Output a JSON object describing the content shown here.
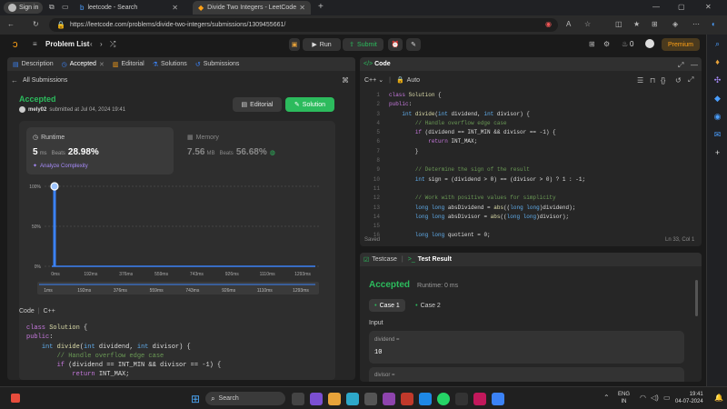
{
  "browser": {
    "signin": "Sign in",
    "tabs": [
      {
        "title": "leetcode - Search"
      },
      {
        "title": "Divide Two Integers - LeetCode"
      }
    ],
    "url": "https://leetcode.com/problems/divide-two-integers/submissions/1309455661/"
  },
  "nav": {
    "problem_list": "Problem List",
    "run": "Run",
    "submit": "Submit",
    "streak": "0",
    "premium": "Premium"
  },
  "left_tabs": [
    "Description",
    "Accepted",
    "Editorial",
    "Solutions",
    "Submissions"
  ],
  "submission": {
    "back": "All Submissions",
    "status": "Accepted",
    "user": "mely02",
    "submitted_text": "submitted at Jul 04, 2024 19:41",
    "editorial_btn": "Editorial",
    "solution_btn": "Solution",
    "runtime_label": "Runtime",
    "runtime_value": "5",
    "runtime_unit": "ms",
    "beats_label": "Beats",
    "runtime_beats": "28.98%",
    "analyze": "Analyze Complexity",
    "memory_label": "Memory",
    "memory_value": "7.56",
    "memory_unit": "MB",
    "memory_beats": "56.68%"
  },
  "chart_data": {
    "type": "bar",
    "ytick_labels": [
      "100%",
      "50%",
      "0%"
    ],
    "x_labels": [
      "0ms",
      "192ms",
      "376ms",
      "559ms",
      "743ms",
      "926ms",
      "1110ms",
      "1293ms"
    ],
    "mini_labels": [
      "1ms",
      "192ms",
      "376ms",
      "559ms",
      "743ms",
      "926ms",
      "1110ms",
      "1293ms"
    ],
    "bars": [
      {
        "x_ms": 5,
        "pct": 100,
        "color": "#3b82f6"
      },
      {
        "x_ms": 0,
        "pct": 0
      }
    ],
    "highlight_ms": 5,
    "ylim": [
      0,
      100
    ]
  },
  "bottom_code": {
    "label": "Code",
    "lang": "C++",
    "lines": [
      "class Solution {",
      "public:",
      "    int divide(int dividend, int divisor) {",
      "        // Handle overflow edge case",
      "        if (dividend == INT_MIN && divisor == -1) {",
      "            return INT_MAX;"
    ]
  },
  "editor": {
    "title": "Code",
    "lang": "C++",
    "mode": "Auto",
    "saved": "Saved",
    "cursor": "Ln 33, Col 1",
    "lines": [
      "class Solution {",
      "public:",
      "    int divide(int dividend, int divisor) {",
      "        // Handle overflow edge case",
      "        if (dividend == INT_MIN && divisor == -1) {",
      "            return INT_MAX;",
      "        }",
      "",
      "        // Determine the sign of the result",
      "        int sign = (dividend > 0) == (divisor > 0) ? 1 : -1;",
      "",
      "        // Work with positive values for simplicity",
      "        long long absDividend = abs((long long)dividend);",
      "        long long absDivisor = abs((long long)divisor);",
      "",
      "        long long quotient = 0;"
    ]
  },
  "result": {
    "tab_testcase": "Testcase",
    "tab_result": "Test Result",
    "status": "Accepted",
    "runtime": "Runtime: 0 ms",
    "case1": "Case 1",
    "case2": "Case 2",
    "input_label": "Input",
    "var1": "dividend =",
    "val1": "10",
    "var2": "divisor ="
  },
  "taskbar": {
    "search": "Search",
    "lang1": "ENG",
    "lang2": "IN",
    "time": "19:41",
    "date": "04-07-2024"
  },
  "colors": {
    "accent_green": "#2cbb5d",
    "accent_orange": "#ffa116",
    "bar_blue": "#3b82f6"
  }
}
